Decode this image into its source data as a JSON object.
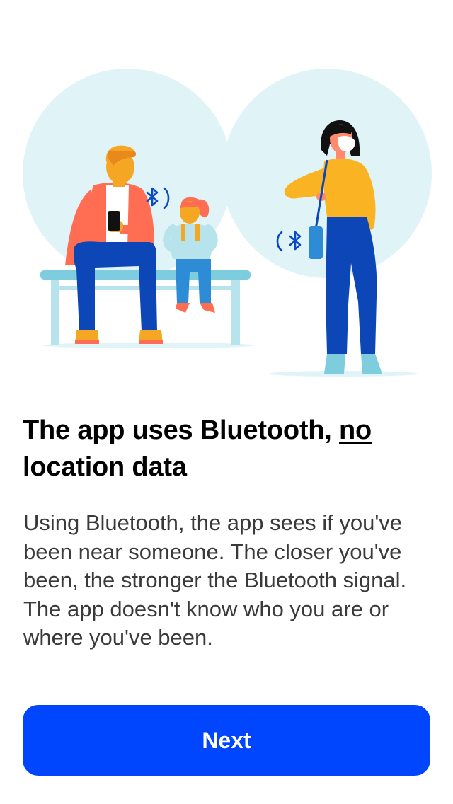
{
  "onboarding": {
    "title_prefix": "The app uses Bluetooth, ",
    "title_underlined": "no",
    "title_suffix": " location data",
    "body": "Using Bluetooth, the app sees if you've been near someone. The closer you've been, the stronger the Bluetooth signal. The app doesn't know who you are or where you've been.",
    "next_label": "Next"
  },
  "illustration": {
    "left_signal_icon": "bluetooth-icon",
    "right_signal_icon": "bluetooth-icon"
  },
  "colors": {
    "primary_button": "#0046ff",
    "circle_background": "#e0f4f7",
    "title_text": "#000000",
    "body_text": "#3a3a3c",
    "bluetooth_icon": "#0a4bc4"
  }
}
